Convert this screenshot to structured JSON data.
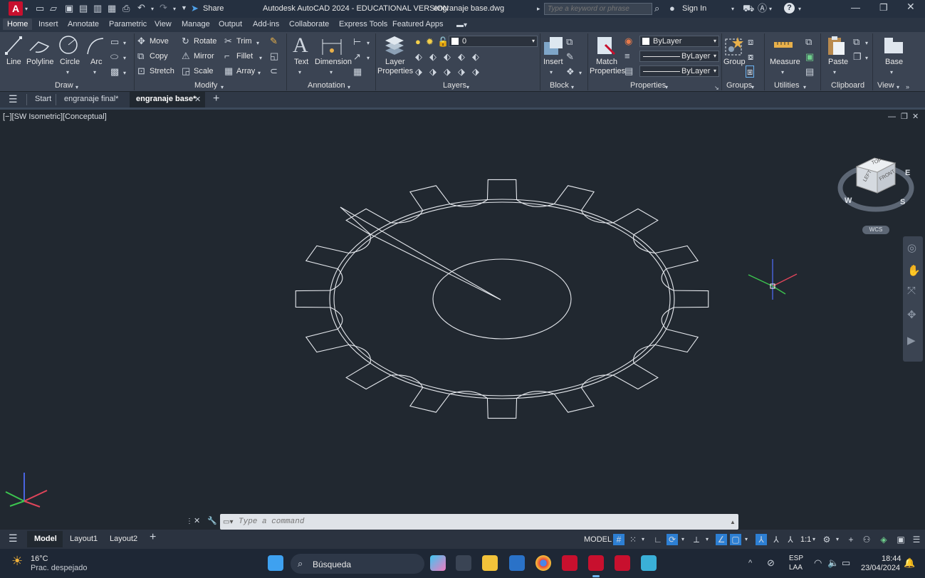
{
  "titlebar": {
    "app_logo": "A",
    "title": "Autodesk AutoCAD 2024 - EDUCATIONAL VERSION",
    "filename": "engranaje base.dwg",
    "share_label": "Share",
    "search_placeholder": "Type a keyword or phrase",
    "signin_label": "Sign In"
  },
  "ribbon_tabs": [
    "Home",
    "Insert",
    "Annotate",
    "Parametric",
    "View",
    "Manage",
    "Output",
    "Add-ins",
    "Collaborate",
    "Express Tools",
    "Featured Apps"
  ],
  "ribbon": {
    "draw": {
      "line": "Line",
      "polyline": "Polyline",
      "circle": "Circle",
      "arc": "Arc",
      "label": "Draw"
    },
    "modify": {
      "move": "Move",
      "rotate": "Rotate",
      "trim": "Trim",
      "copy": "Copy",
      "mirror": "Mirror",
      "fillet": "Fillet",
      "stretch": "Stretch",
      "scale": "Scale",
      "array": "Array",
      "label": "Modify"
    },
    "annotation": {
      "text": "Text",
      "dimension": "Dimension",
      "label": "Annotation"
    },
    "layers": {
      "layer_properties_1": "Layer",
      "layer_properties_2": "Properties",
      "current_layer": "0",
      "label": "Layers"
    },
    "block": {
      "insert": "Insert",
      "label": "Block"
    },
    "properties": {
      "match_1": "Match",
      "match_2": "Properties",
      "color": "ByLayer",
      "linetype": "ByLayer",
      "lineweight": "ByLayer",
      "label": "Properties"
    },
    "groups": {
      "group": "Group",
      "label": "Groups"
    },
    "utilities": {
      "measure": "Measure",
      "label": "Utilities"
    },
    "clipboard": {
      "paste": "Paste",
      "label": "Clipboard"
    },
    "view": {
      "base": "Base",
      "label": "View"
    }
  },
  "doc_tabs": {
    "start": "Start",
    "file1": "engranaje final*",
    "file2": "engranaje base*"
  },
  "viewport": {
    "label": "[−][SW Isometric][Conceptual]",
    "wcs": "WCS",
    "viewcube_top": "TOP",
    "viewcube_left": "LEFT",
    "viewcube_front": "FRONT",
    "compass_w": "W",
    "compass_s": "S",
    "compass_e": "E"
  },
  "command": {
    "placeholder": "Type a command"
  },
  "layout_tabs": {
    "model": "Model",
    "layout1": "Layout1",
    "layout2": "Layout2"
  },
  "status": {
    "model": "MODEL",
    "scale": "1:1"
  },
  "taskbar": {
    "temp": "16°C",
    "weather": "Prac. despejado",
    "search": "Búsqueda",
    "lang1": "ESP",
    "lang2": "LAA",
    "time": "18:44",
    "date": "23/04/2024"
  },
  "colors": {
    "accent": "#c8102e",
    "active_blue": "#2d7fd3"
  }
}
